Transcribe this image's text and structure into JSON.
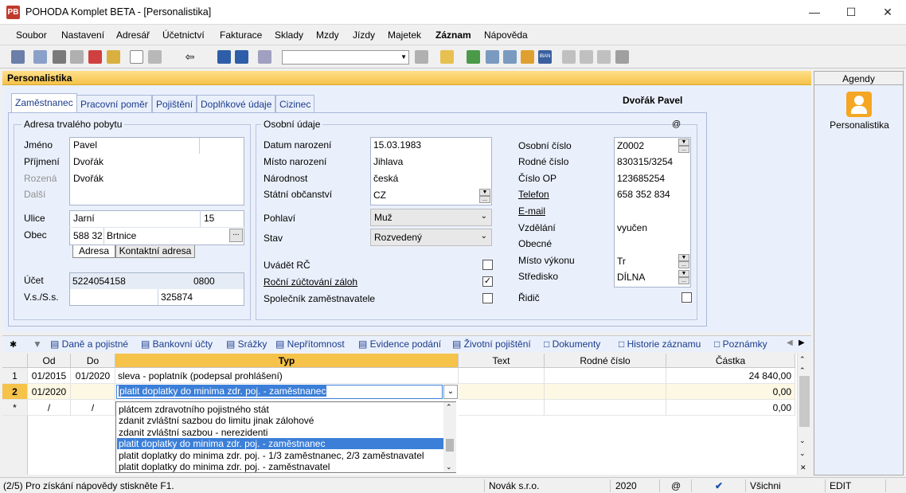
{
  "window": {
    "title": "POHODA Komplet BETA - [Personalistika]",
    "app_icon": "PB"
  },
  "menu": [
    "Soubor",
    "Nastavení",
    "Adresář",
    "Účetnictví",
    "Fakturace",
    "Sklady",
    "Mzdy",
    "Jízdy",
    "Majetek",
    "Záznam",
    "Nápověda"
  ],
  "agenda_title": "Personalistika",
  "employee_name": "Dvořák Pavel",
  "tabs": [
    "Zaměstnanec",
    "Pracovní poměr",
    "Pojištění",
    "Doplňkové údaje",
    "Cizinec"
  ],
  "address": {
    "title": "Adresa trvalého pobytu",
    "labels": {
      "jmeno": "Jméno",
      "prijmeni": "Příjmení",
      "rozena": "Rozená",
      "dalsi": "Další",
      "ulice": "Ulice",
      "obec": "Obec",
      "ucet": "Účet",
      "vss": "V.s./S.s."
    },
    "jmeno": "Pavel",
    "prijmeni": "Dvořák",
    "rozena": "Dvořák",
    "ulice": "Jarní",
    "cislo": "15",
    "psc": "588 32",
    "obec": "Brtnice",
    "subtabs": [
      "Adresa",
      "Kontaktní adresa"
    ],
    "ucet": "5224054158",
    "banka": "0800",
    "vs": "325874"
  },
  "personal": {
    "title": "Osobní údaje",
    "labels": {
      "datum": "Datum narození",
      "misto": "Místo narození",
      "narodnost": "Národnost",
      "obcanstvi": "Státní občanství",
      "pohlavi": "Pohlaví",
      "stav": "Stav",
      "uvadet": "Uvádět RČ",
      "rocni": "Roční zúčtování záloh",
      "spolecnik": "Společník zaměstnavatele"
    },
    "datum": "15.03.1983",
    "misto": "Jihlava",
    "narodnost": "česká",
    "obcanstvi": "CZ",
    "pohlavi": "Muž",
    "stav": "Rozvedený",
    "uvadet_checked": false,
    "rocni_checked": true,
    "spolecnik_checked": false
  },
  "right_fields": {
    "labels": {
      "osobni": "Osobní číslo",
      "rodne": "Rodné číslo",
      "op": "Číslo OP",
      "telefon": "Telefon",
      "email": "E-mail",
      "vzdelani": "Vzdělání",
      "obecne": "Obecné",
      "misto_vykonu": "Místo výkonu",
      "stredisko": "Středisko",
      "ridic": "Řidič"
    },
    "osobni": "Z0002",
    "rodne": "830315/3254",
    "op": "123685254",
    "telefon": "658 352 834",
    "vzdelani": "vyučen",
    "misto_vykonu": "Tr",
    "stredisko": "DÍLNA",
    "ridic_checked": false
  },
  "subtabs": [
    "Daně a pojistné",
    "Bankovní účty",
    "Srážky",
    "Nepřítomnost",
    "Evidence podání",
    "Životní pojištění",
    "Dokumenty",
    "Historie záznamu",
    "Poznámky"
  ],
  "grid": {
    "columns": [
      "Od",
      "Do",
      "Typ",
      "Text",
      "Rodné číslo",
      "Částka"
    ],
    "rows": [
      {
        "n": "1",
        "od": "01/2015",
        "do": "01/2020",
        "typ": "sleva - poplatník (podepsal prohlášení)",
        "text": "",
        "rc": "",
        "castka": "24 840,00"
      },
      {
        "n": "2",
        "od": "01/2020",
        "do": "",
        "typ": "platit doplatky do minima zdr. poj. - zaměstnanec",
        "text": "",
        "rc": "",
        "castka": "0,00"
      },
      {
        "n": "*",
        "od": "/",
        "do": "/",
        "typ": "",
        "text": "",
        "rc": "",
        "castka": "0,00"
      }
    ]
  },
  "dropdown_options": [
    "plátcem zdravotního pojistného stát",
    "zdanit zvláštní sazbou do limitu jinak zálohové",
    "zdanit zvláštní sazbou - nerezidenti",
    "platit doplatky do minima zdr. poj. - zaměstnanec",
    "platit doplatky do minima zdr. poj. - 1/3 zaměstnanec, 2/3 zaměstnavatel",
    "platit doplatky do minima zdr. poj. - zaměstnavatel"
  ],
  "agendy": {
    "title": "Agendy",
    "item": "Personalistika"
  },
  "status": {
    "help": "(2/5) Pro získání nápovědy stiskněte F1.",
    "company": "Novák s.r.o.",
    "year": "2020",
    "at": "@",
    "filter": "Všichni",
    "mode": "EDIT"
  }
}
